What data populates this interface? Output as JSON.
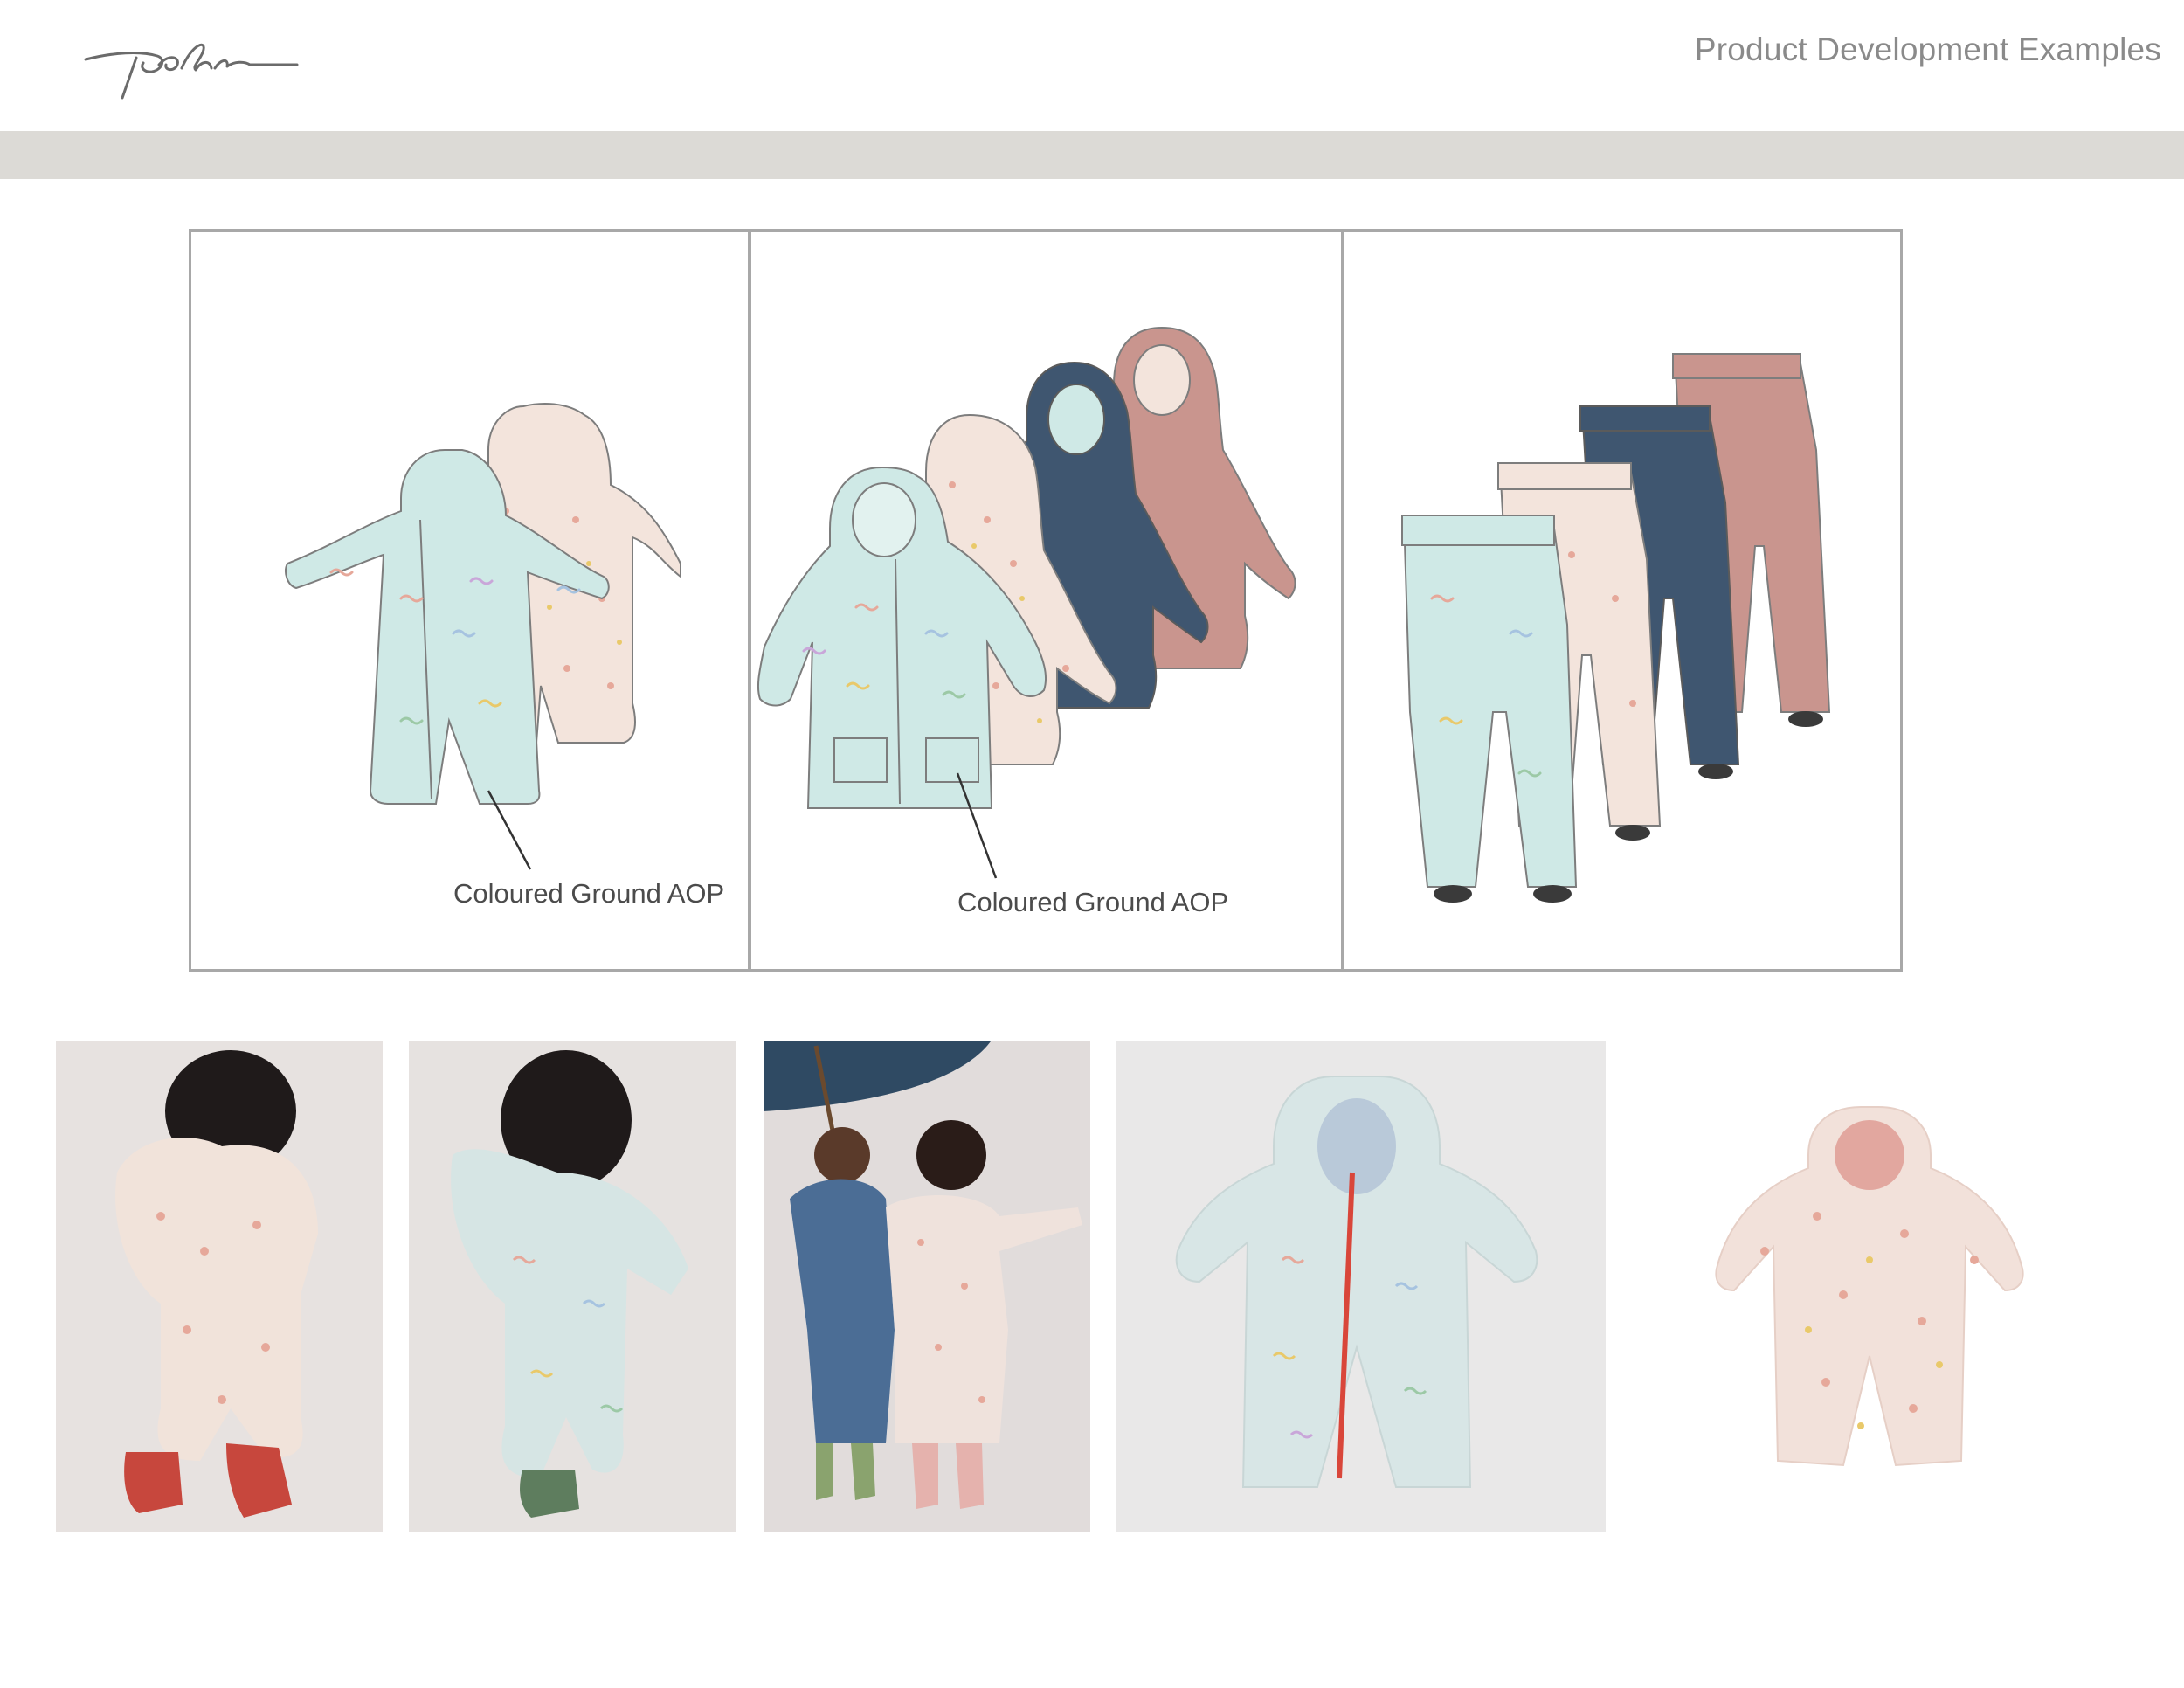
{
  "header": {
    "logo_text": "pehr",
    "page_title": "Product Development Examples"
  },
  "sketches": {
    "panel_1": {
      "callout": "Coloured Ground AOP"
    },
    "panel_2": {
      "callout": "Coloured Ground AOP"
    }
  },
  "colors": {
    "band": "#dcdad6",
    "mint": "#cfe9e6",
    "floral": "#f3e4dc",
    "navy": "#3f5670",
    "rose": "#c9958e",
    "frame": "#a8a8a8"
  },
  "photos": [
    {
      "name": "toddler-floral-suit-back"
    },
    {
      "name": "toddler-mint-suit-back"
    },
    {
      "name": "two-kids-umbrella"
    },
    {
      "name": "mint-suit-flatlay"
    },
    {
      "name": "floral-suit-cutout"
    }
  ]
}
